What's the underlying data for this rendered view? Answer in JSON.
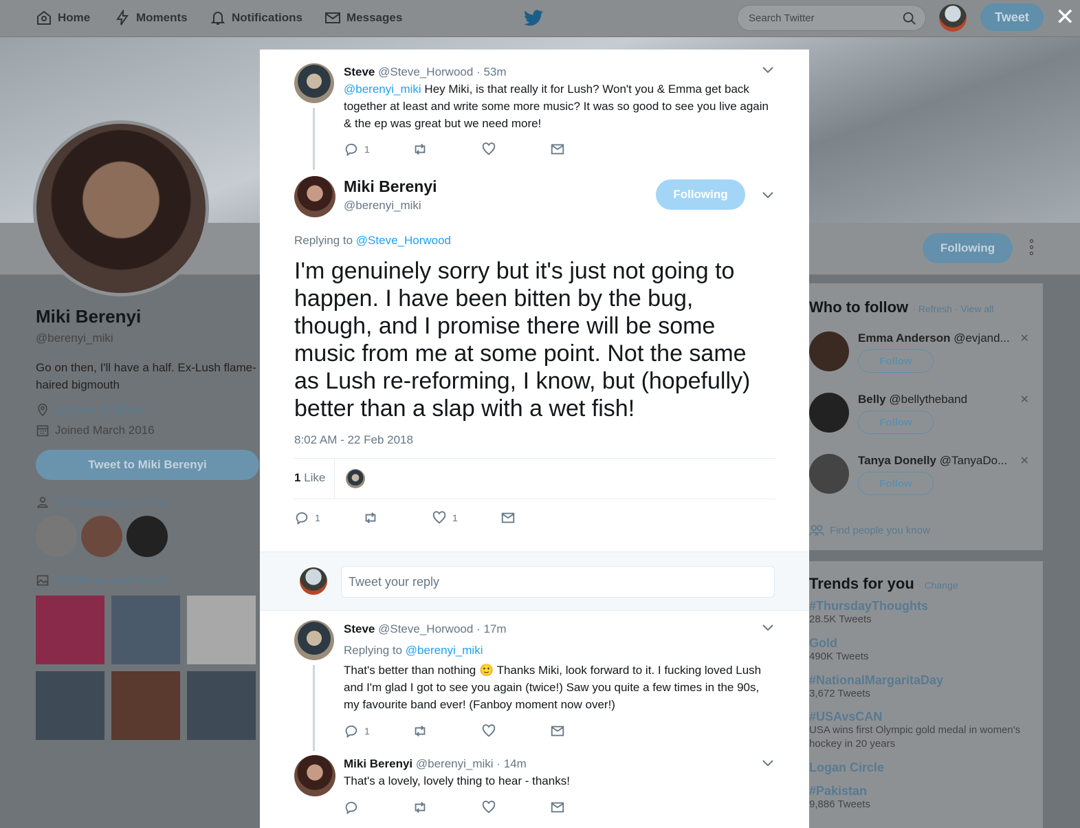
{
  "nav": {
    "home": "Home",
    "moments": "Moments",
    "notifications": "Notifications",
    "messages": "Messages",
    "search_placeholder": "Search Twitter",
    "tweet": "Tweet"
  },
  "profile": {
    "name": "Miki Berenyi",
    "handle": "@berenyi_miki",
    "bio": "Go on then, I'll have a half. Ex-Lush flame-haired bigmouth",
    "location": "London, England",
    "joined": "Joined March 2016",
    "tweet_to": "Tweet to Miki Berenyi",
    "followers_you_know": "3 Followers you know",
    "photos": "24 Photos and videos",
    "following": "Following"
  },
  "wtf": {
    "title": "Who to follow",
    "refresh": "Refresh",
    "view_all": "View all",
    "find": "Find people you know",
    "follow": "Follow",
    "items": [
      {
        "name": "Emma Anderson",
        "handle": "@evjand..."
      },
      {
        "name": "Belly",
        "handle": "@bellytheband"
      },
      {
        "name": "Tanya Donelly",
        "handle": "@TanyaDo..."
      }
    ]
  },
  "trends": {
    "title": "Trends for you",
    "change": "Change",
    "items": [
      {
        "tag": "#ThursdayThoughts",
        "sub": "28.5K Tweets"
      },
      {
        "tag": "Gold",
        "sub": "490K Tweets"
      },
      {
        "tag": "#NationalMargaritaDay",
        "sub": "3,672 Tweets"
      },
      {
        "tag": "#USAvsCAN",
        "sub": "USA wins first Olympic gold medal in women's hockey in 20 years"
      },
      {
        "tag": "Logan Circle",
        "sub": ""
      },
      {
        "tag": "#Pakistan",
        "sub": "9,886 Tweets"
      }
    ]
  },
  "modal": {
    "t1": {
      "name": "Steve",
      "handle": "@Steve_Horwood",
      "time": "· 53m",
      "mention": "@berenyi_miki",
      "text": " Hey Miki, is that really it for Lush? Won't you & Emma get back together at least and write some more music? It was so good to see you live again & the ep was great but we need more!",
      "replies": "1"
    },
    "main": {
      "name": "Miki Berenyi",
      "handle": "@berenyi_miki",
      "following": "Following",
      "replying": "Replying to",
      "replying_to": "@Steve_Horwood",
      "text": "I'm genuinely sorry but it's just not going to happen. I have been bitten by the bug, though, and I promise there will be some music from me at some point. Not the same as Lush re-reforming, I know, but (hopefully) better than a slap with a wet fish!",
      "timestamp": "8:02 AM - 22 Feb 2018",
      "likes_count": "1",
      "likes_label": "Like",
      "replies": "1",
      "likes": "1"
    },
    "reply_placeholder": "Tweet your reply",
    "t2": {
      "name": "Steve",
      "handle": "@Steve_Horwood",
      "time": "· 17m",
      "replying": "Replying to",
      "replying_to": "@berenyi_miki",
      "text": "That's better than nothing 🙂 Thanks Miki, look forward to it. I fucking loved Lush and I'm glad I got to see you again (twice!) Saw you quite a few times in the 90s, my favourite band ever! (Fanboy moment now over!)",
      "replies": "1"
    },
    "t3": {
      "name": "Miki Berenyi",
      "handle": "@berenyi_miki",
      "time": "· 14m",
      "text": "That's a lovely, lovely thing to hear - thanks!"
    }
  }
}
